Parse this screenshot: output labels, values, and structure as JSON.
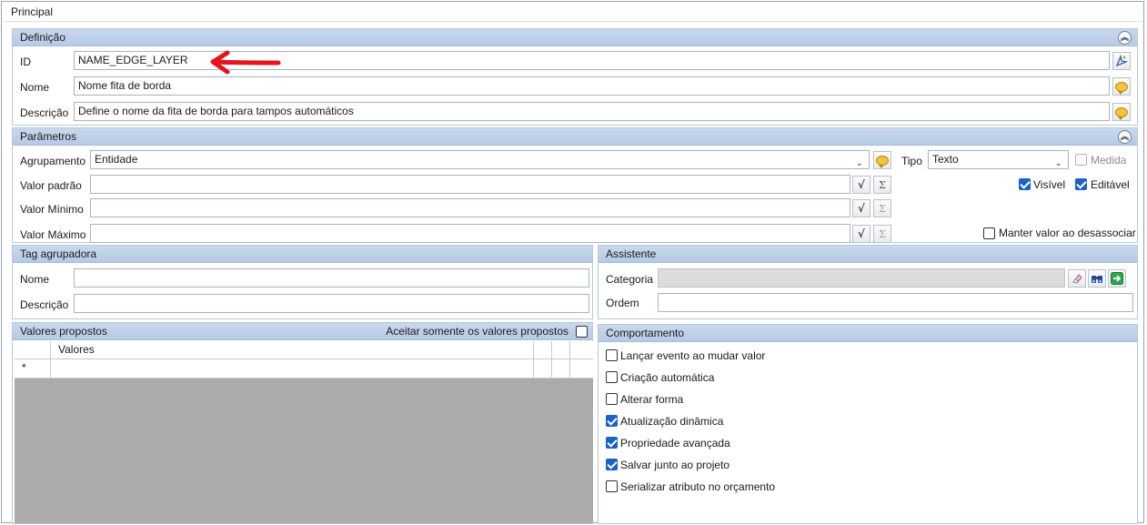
{
  "window": {
    "title": "Principal"
  },
  "definicao": {
    "header": "Definição",
    "id_label": "ID",
    "id_value": "NAME_EDGE_LAYER",
    "nome_label": "Nome",
    "nome_value": "Nome fita de borda",
    "descricao_label": "Descrição",
    "descricao_value": "Define o nome da fita de borda para tampos automáticos"
  },
  "parametros": {
    "header": "Parâmetros",
    "agrupamento_label": "Agrupamento",
    "agrupamento_value": "Entidade",
    "tipo_label": "Tipo",
    "tipo_value": "Texto",
    "medida_label": "Medida",
    "medida_checked": false,
    "valor_padrao_label": "Valor padrão",
    "valor_minimo_label": "Valor Mínimo",
    "valor_maximo_label": "Valor Máximo",
    "visivel_label": "Visível",
    "visivel_checked": true,
    "editavel_label": "Editável",
    "editavel_checked": true,
    "manter_label": "Manter valor ao desassociar",
    "manter_checked": false
  },
  "tag": {
    "header": "Tag agrupadora",
    "nome_label": "Nome",
    "descricao_label": "Descrição"
  },
  "assistente": {
    "header": "Assistente",
    "categoria_label": "Categoria",
    "ordem_label": "Ordem"
  },
  "valores": {
    "header": "Valores propostos",
    "aceitar_label": "Aceitar somente os valores propostos",
    "column_header": "Valores",
    "new_row_marker": "*"
  },
  "comportamento": {
    "header": "Comportamento",
    "items": [
      {
        "label": "Lançar evento ao mudar valor",
        "checked": false
      },
      {
        "label": "Criação automática",
        "checked": false
      },
      {
        "label": "Alterar forma",
        "checked": false
      },
      {
        "label": "Atualização dinâmica",
        "checked": true
      },
      {
        "label": "Propriedade avançada",
        "checked": true
      },
      {
        "label": "Salvar junto ao projeto",
        "checked": true
      },
      {
        "label": "Serializar atributo no orçamento",
        "checked": false
      }
    ]
  },
  "icons": {
    "collapse": "double-chevron-up-icon",
    "translate": "speech-bubble-icon",
    "formula": "square-root-icon",
    "sum": "sigma-icon",
    "eraser": "eraser-icon",
    "search": "binoculars-icon",
    "go": "green-arrow-icon",
    "annotation": "red-arrow-icon"
  },
  "colors": {
    "section_header": "#b6cae4",
    "checkbox_checked": "#1a63c6",
    "grid_background": "#ababab",
    "annotation_arrow": "#e8141b"
  }
}
